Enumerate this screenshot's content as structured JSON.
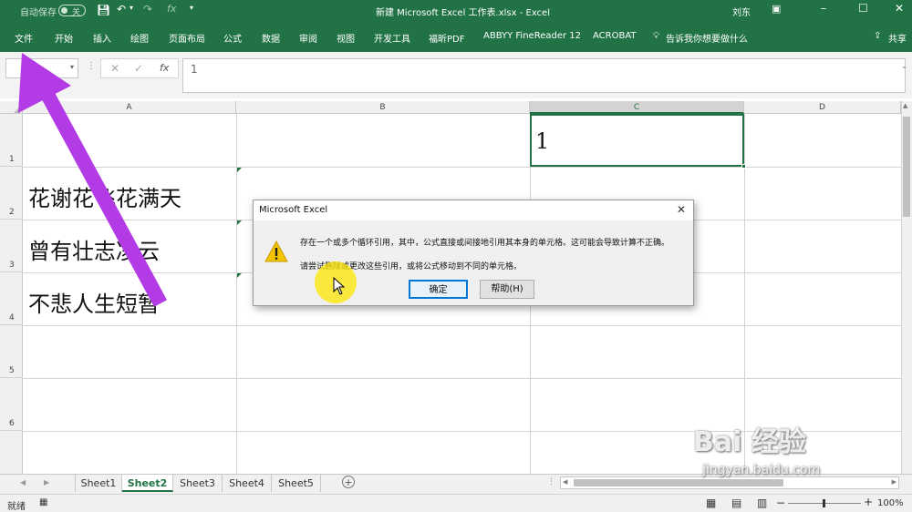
{
  "window": {
    "title": "新建 Microsoft Excel 工作表.xlsx  -  Excel",
    "autosave_label": "自动保存",
    "autosave_state": "关",
    "user": "刘东"
  },
  "ribbon": {
    "tabs": [
      "文件",
      "开始",
      "插入",
      "绘图",
      "页面布局",
      "公式",
      "数据",
      "审阅",
      "视图",
      "开发工具",
      "福昕PDF",
      "ABBYY FineReader 12",
      "ACROBAT"
    ],
    "tell_me": "告诉我你想要做什么",
    "share": "共享"
  },
  "formula_bar": {
    "name_box": "",
    "fx": "fx",
    "value": "1"
  },
  "grid": {
    "columns": [
      "A",
      "B",
      "C",
      "D"
    ],
    "selected_column": "C",
    "rows": [
      "1",
      "2",
      "3",
      "4",
      "5",
      "6"
    ],
    "cells": {
      "C1": "1",
      "A2": "花谢花飞花满天",
      "A3": "曾有壮志凌云",
      "A4": "不悲人生短暂"
    }
  },
  "sheets": [
    "Sheet1",
    "Sheet2",
    "Sheet3",
    "Sheet4",
    "Sheet5"
  ],
  "active_sheet": "Sheet2",
  "status": {
    "mode": "就绪",
    "zoom": "100%"
  },
  "dialog": {
    "title": "Microsoft Excel",
    "message_1": "存在一个或多个循环引用，其中，公式直接或间接地引用其本身的单元格。这可能会导致计算不正确。",
    "message_2": "请尝试删除或更改这些引用，或将公式移动到不同的单元格。",
    "ok_label": "确定",
    "help_label": "帮助(H)"
  },
  "watermark": {
    "brand": "Bai 经验",
    "url": "jingyan.baidu.com"
  },
  "colors": {
    "excel_green": "#217346",
    "annotation_arrow": "#b23be6"
  }
}
